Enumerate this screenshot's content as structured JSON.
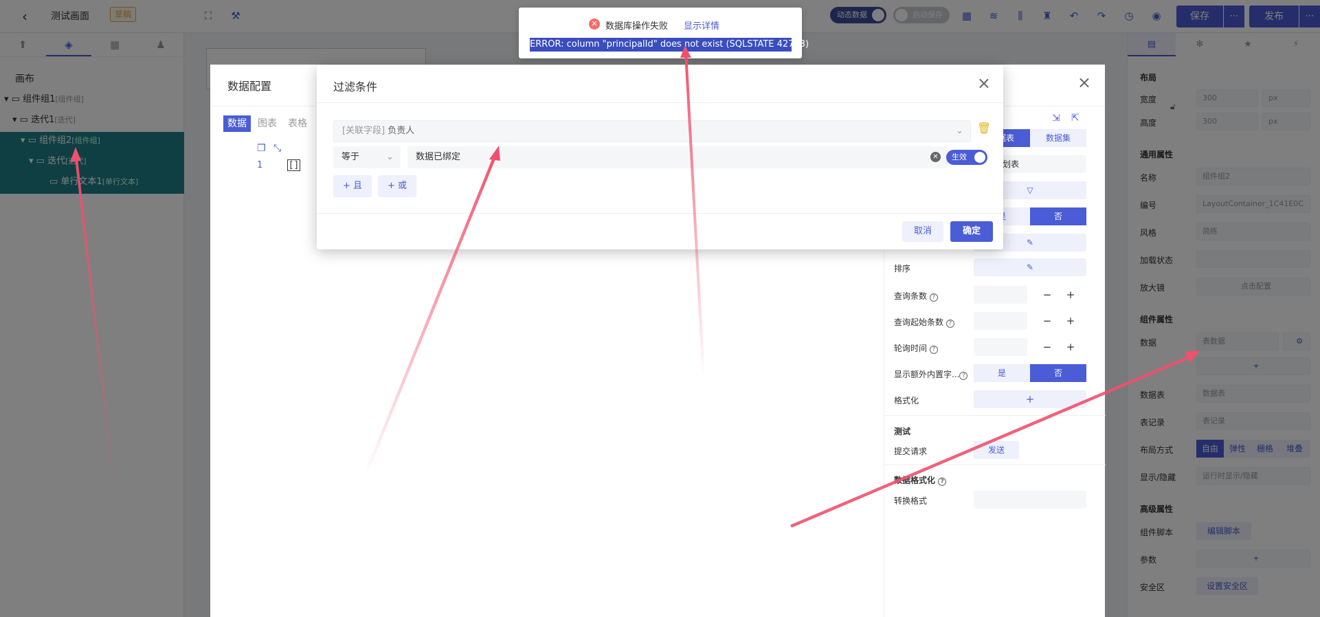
{
  "topbar": {
    "back_icon": "chevron-left-icon",
    "page_name": "测试画面",
    "draft_badge": "草稿",
    "dynamic_data_label": "动态数据",
    "autosave_label": "启动保存",
    "save_label": "保存",
    "more_label": "⋯",
    "publish_label": "发布"
  },
  "left": {
    "canvas_label": "画布",
    "tree": [
      {
        "name": "组件组1",
        "tag": "[组件组]"
      },
      {
        "name": "迭代1",
        "tag": "[迭代]"
      },
      {
        "name": "组件组2",
        "tag": "[组件组]"
      },
      {
        "name": "迭代",
        "tag": "[迭代]"
      },
      {
        "name": "单行文本1",
        "tag": "[单行文本]"
      }
    ]
  },
  "right": {
    "layout_title": "布局",
    "width_label": "宽度",
    "width_value": "300",
    "height_label": "高度",
    "height_value": "300",
    "unit": "px",
    "general_title": "通用属性",
    "name_label": "名称",
    "name_value": "组件组2",
    "id_label": "编号",
    "id_value": "LayoutContainer_1C41E0C",
    "style_label": "风格",
    "style_value": "简练",
    "loading_label": "加载状态",
    "magnifier_label": "放大镜",
    "magnifier_value": "点击配置",
    "component_title": "组件属性",
    "data_label": "数据",
    "data_value": "表数据",
    "datatable_label": "数据表",
    "datatable_value": "数据表",
    "record_label": "表记录",
    "record_value": "表记录",
    "layout_mode_label": "布局方式",
    "layout_modes": [
      "自由",
      "弹性",
      "栅格",
      "堆叠"
    ],
    "visibility_label": "显示/隐藏",
    "visibility_value": "运行时显示/隐藏",
    "advanced_title": "高级属性",
    "script_label": "组件脚本",
    "script_value": "编辑脚本",
    "params_label": "参数",
    "safe_label": "安全区",
    "safe_value": "设置安全区"
  },
  "dataconfig": {
    "title": "数据配置",
    "tabs": [
      "数据",
      "图表",
      "表格"
    ],
    "line_no": "1",
    "code": "[]",
    "tab_table": "数据表",
    "tab_dataset": "数据集",
    "table_value": "计划表",
    "yes": "是",
    "no": "否",
    "sort_label": "排序",
    "count_label": "查询条数",
    "start_label": "查询起始条数",
    "poll_label": "轮询时间",
    "extra_label": "显示额外内置字...",
    "format_label": "格式化",
    "test_title": "测试",
    "submit_label": "提交请求",
    "send_label": "发送",
    "dformat_title": "数据格式化",
    "convert_label": "转换格式",
    "minus": "−",
    "plus": "+"
  },
  "filter": {
    "title": "过滤条件",
    "field_prefix": "[关联字段]",
    "field_name": "负责人",
    "operator": "等于",
    "value": "数据已绑定",
    "switch_label": "生效",
    "add_and": "+ 且",
    "add_or": "+ 或",
    "cancel": "取消",
    "ok": "确定"
  },
  "notify": {
    "message": "数据库操作失败",
    "detail_link": "显示详情",
    "error_text": "ERROR: column \"principalId\" does not exist (SQLSTATE 42703)"
  },
  "colors": {
    "accent": "#4a5dd6",
    "error": "#f56c6c",
    "arrow": "#f0506e",
    "tree_highlight": "#1f7f86"
  }
}
